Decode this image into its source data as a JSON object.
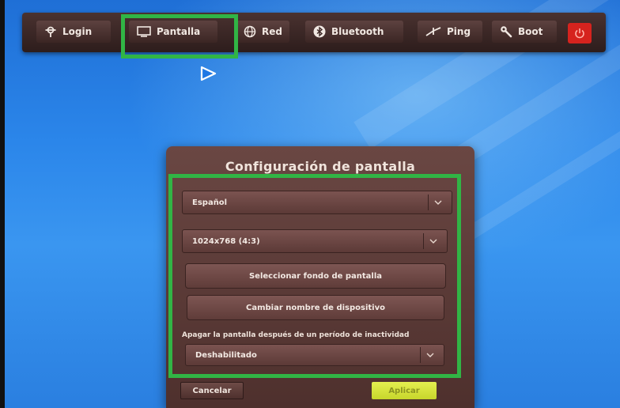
{
  "toolbar": {
    "items": [
      {
        "label": "Login",
        "icon": "login-icon"
      },
      {
        "label": "Pantalla",
        "icon": "monitor-icon"
      },
      {
        "label": "Red",
        "icon": "network-globe-icon"
      },
      {
        "label": "Bluetooth",
        "icon": "bluetooth-icon"
      },
      {
        "label": "Ping",
        "icon": "ping-icon"
      },
      {
        "label": "Boot",
        "icon": "wrench-icon"
      }
    ],
    "power_icon": "power-icon",
    "power_color": "#d6231e"
  },
  "dialog": {
    "title": "Configuración de pantalla",
    "language_select": {
      "value": "Español"
    },
    "resolution_select": {
      "value": "1024x768 (4:3)"
    },
    "wallpaper_button": "Seleccionar fondo de pantalla",
    "rename_button": "Cambiar nombre de dispositivo",
    "sleep_label": "Apagar la pantalla después de un período de inactividad",
    "sleep_select": {
      "value": "Deshabilitado"
    },
    "cancel_button": "Cancelar",
    "apply_button": "Aplicar"
  },
  "colors": {
    "highlight": "#31b545",
    "dialog_bg": "#5c3a37",
    "desktop_bg": "#2b86ea",
    "apply_button": "#d4e23a"
  }
}
